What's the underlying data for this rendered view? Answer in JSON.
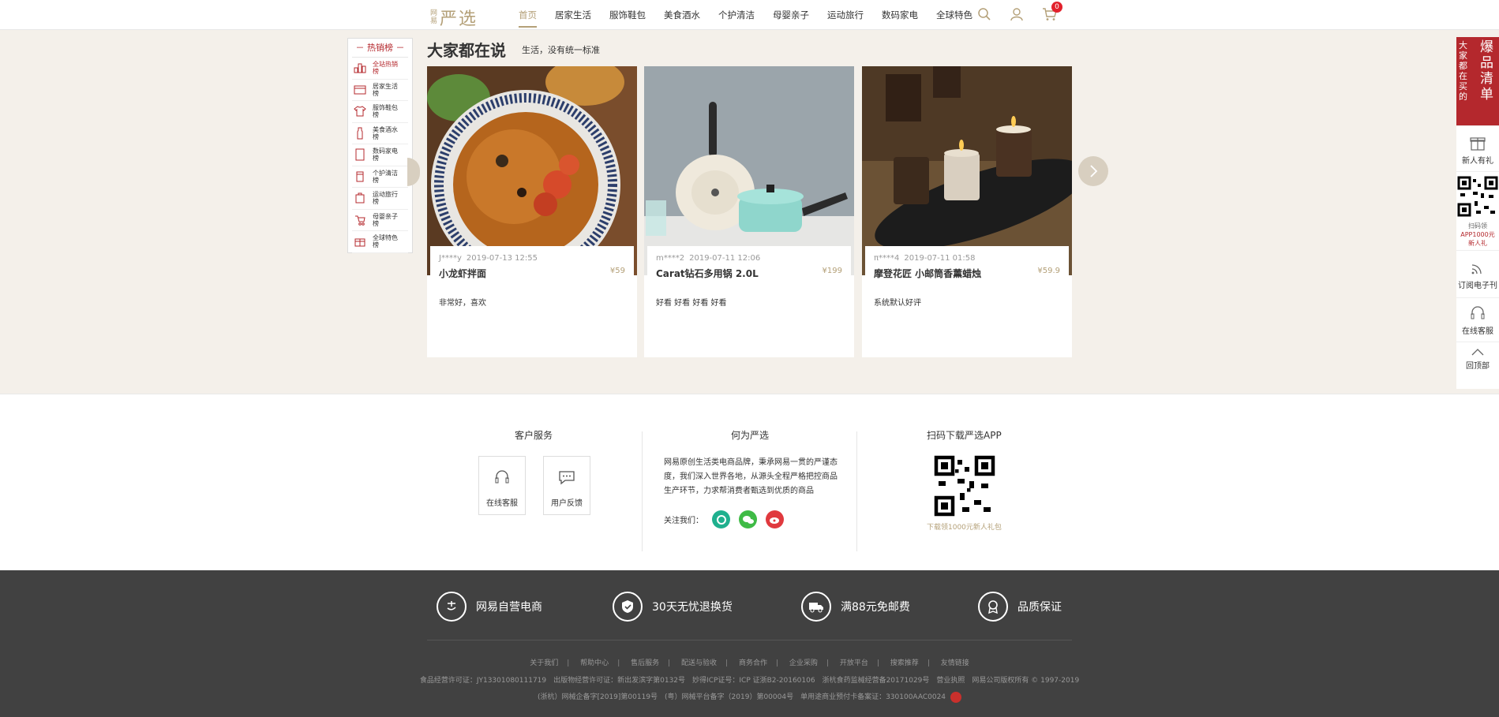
{
  "logo": {
    "small": "网易",
    "big": "严选"
  },
  "nav": {
    "items": [
      "首页",
      "居家生活",
      "服饰鞋包",
      "美食酒水",
      "个护清洁",
      "母婴亲子",
      "运动旅行",
      "数码家电",
      "全球特色"
    ],
    "cart_count": "0"
  },
  "sidebar": {
    "header": "－ 热销榜 －",
    "items": [
      "全站热销榜",
      "居家生活榜",
      "服饰鞋包榜",
      "美食酒水榜",
      "数码家电榜",
      "个护清洁榜",
      "运动旅行榜",
      "母婴亲子榜",
      "全球特色榜"
    ]
  },
  "section": {
    "title": "大家都在说",
    "subtitle": "生活，没有统一标准"
  },
  "cards": [
    {
      "user": "J****y",
      "date": "2019-07-13 12:55",
      "name": "小龙虾拌面",
      "price": "¥59",
      "comment": "非常好，喜欢"
    },
    {
      "user": "m****2",
      "date": "2019-07-11 12:06",
      "name": "Carat钻石多用锅 2.0L",
      "price": "¥199",
      "comment": "好看 好看 好看 好看"
    },
    {
      "user": "π****4",
      "date": "2019-07-11 01:58",
      "name": "摩登花匠 小邮筒香薰蜡烛",
      "price": "¥59.9",
      "comment": "系统默认好评"
    }
  ],
  "rightbar": {
    "banner_big": "爆品清单",
    "banner_small": "大家都在买的",
    "gift": "新人有礼",
    "qr_line1": "扫码领",
    "qr_line2": "APP1000元",
    "qr_line3": "新人礼",
    "subscribe": "订阅电子刊",
    "service": "在线客服",
    "top": "回顶部"
  },
  "footer": {
    "col1_title": "客户服务",
    "online_service": "在线客服",
    "feedback": "用户反馈",
    "col2_title": "何为严选",
    "about": "网易原创生活类电商品牌，秉承网易一贯的严谨态度，我们深入世界各地，从源头全程严格把控商品生产环节，力求帮消费者甄选到优质的商品",
    "follow": "关注我们：",
    "col3_title": "扫码下载严选APP",
    "qr_caption": "下载领1000元新人礼包",
    "promos": [
      "网易自营电商",
      "30天无忧退换货",
      "满88元免邮费",
      "品质保证"
    ],
    "links": [
      "关于我们",
      "帮助中心",
      "售后服务",
      "配送与验收",
      "商务合作",
      "企业采购",
      "开放平台",
      "搜索推荐",
      "友情链接"
    ],
    "license1": "食品经营许可证：JY13301080111719　出版物经营许可证：新出发滨字第0132号　妙得ICP证号：ICP 证浙B2-20160106　浙杭食药监械经营备20171029号　营业执照　网易公司版权所有 © 1997-2019",
    "license2": "(浙杭）网械企备字[2019]第00119号　(粤）网械平台备字（2019）第00004号　单用途商业预付卡备案证：330100AAC0024"
  },
  "colors": {
    "accent": "#b4a078",
    "brand_red": "#b4282d",
    "bg": "#f4f0ea",
    "footer_dark": "#414141"
  }
}
